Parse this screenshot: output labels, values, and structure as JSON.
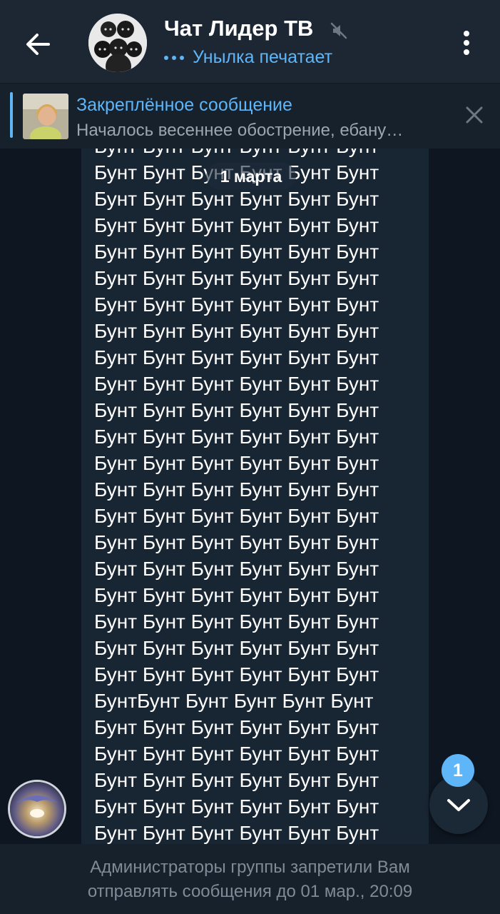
{
  "header": {
    "title": "Чат Лидер ТВ",
    "status": "Унылка печатает",
    "icons": [
      "back-arrow-icon",
      "group-avatar",
      "muted-icon",
      "more-vertical-icon"
    ]
  },
  "pinned": {
    "title": "Закреплённое сообщение",
    "text": "Началось весеннее обострение, ебану…",
    "icons": [
      "pinned-thumbnail",
      "close-icon"
    ]
  },
  "chat": {
    "date": "1 марта",
    "message_lines": [
      "Бунт Бунт Бунт Бунт Бунт Бунт",
      "Бунт Бунт Бунт Бунт Бунт Бунт",
      "Бунт Бунт Бунт Бунт Бунт Бунт",
      "Бунт Бунт Бунт Бунт Бунт Бунт",
      "Бунт Бунт Бунт Бунт Бунт Бунт",
      "Бунт Бунт Бунт Бунт Бунт Бунт",
      "Бунт Бунт Бунт Бунт Бунт Бунт",
      "Бунт Бунт Бунт Бунт Бунт Бунт",
      "Бунт Бунт Бунт Бунт Бунт Бунт",
      "Бунт Бунт Бунт Бунт Бунт Бунт",
      "Бунт Бунт Бунт Бунт Бунт Бунт",
      "Бунт Бунт Бунт Бунт Бунт Бунт",
      "Бунт Бунт Бунт Бунт Бунт Бунт",
      "Бунт Бунт Бунт Бунт Бунт Бунт",
      "Бунт Бунт Бунт Бунт Бунт Бунт",
      "Бунт Бунт Бунт Бунт Бунт Бунт",
      "Бунт Бунт Бунт Бунт Бунт Бунт",
      "Бунт Бунт Бунт Бунт Бунт Бунт",
      "Бунт Бунт Бунт Бунт Бунт Бунт",
      "Бунт Бунт Бунт Бунт Бунт Бунт",
      "Бунт Бунт Бунт Бунт Бунт Бунт",
      "БунтБунт Бунт Бунт Бунт Бунт",
      "Бунт Бунт Бунт Бунт Бунт Бунт",
      "Бунт Бунт Бунт Бунт Бунт Бунт",
      "Бунт Бунт Бунт Бунт Бунт Бунт",
      "Бунт Бунт Бунт Бунт Бунт Бунт",
      "Бунт Бунт Бунт Бунт Бунт Бунт",
      "Бунт Бунт Бунт Бунт Бунт Бунт"
    ],
    "unread_count": "1",
    "icons": [
      "sender-avatar",
      "scroll-down-chevron-icon"
    ]
  },
  "footer": {
    "line1": "Администраторы группы запретили Вам",
    "line2": "отправлять сообщения до 01 мар., 20:09"
  },
  "colors": {
    "background": "#0e1621",
    "header": "#1c2733",
    "pinned_bar": "#17212b",
    "bubble": "#182533",
    "accent": "#5eb5f7",
    "muted_text": "#7f8b96"
  }
}
